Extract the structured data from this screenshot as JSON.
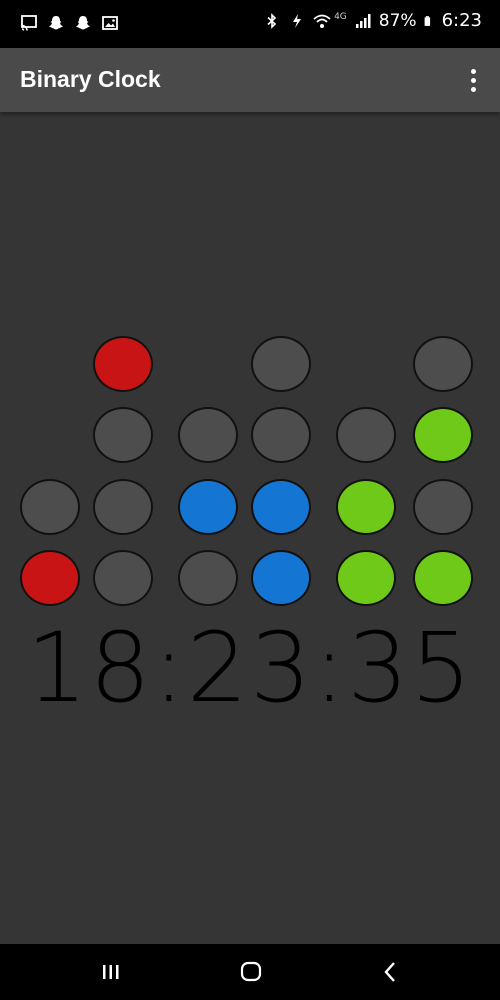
{
  "status_bar": {
    "battery": "87%",
    "time": "6:23",
    "left_icons": [
      "cast-icon",
      "snapchat-icon",
      "snapchat-icon",
      "image-icon"
    ],
    "right_icons": [
      "bluetooth-icon",
      "data-saver-icon",
      "wifi-icon",
      "signal-icon",
      "battery-icon"
    ],
    "network_label": "4G"
  },
  "app_bar": {
    "title": "Binary Clock",
    "menu_icon": "more-vert-icon"
  },
  "colors": {
    "background": "#353535",
    "off": "#4d4d4d",
    "hours_on": "#c81414",
    "minutes_on": "#1476d2",
    "seconds_on": "#6fc918",
    "border": "#111111"
  },
  "clock": {
    "time_text": "18:23:35",
    "hours": 18,
    "minutes": 23,
    "seconds": 35,
    "columns": [
      {
        "unit": "hours",
        "digit": 1,
        "bits": [
          null,
          null,
          0,
          1
        ]
      },
      {
        "unit": "hours",
        "digit": 8,
        "bits": [
          1,
          0,
          0,
          0
        ]
      },
      {
        "unit": "minutes",
        "digit": 2,
        "bits": [
          null,
          0,
          1,
          0
        ]
      },
      {
        "unit": "minutes",
        "digit": 3,
        "bits": [
          0,
          0,
          1,
          1
        ]
      },
      {
        "unit": "seconds",
        "digit": 3,
        "bits": [
          null,
          0,
          1,
          1
        ]
      },
      {
        "unit": "seconds",
        "digit": 5,
        "bits": [
          0,
          1,
          0,
          1
        ]
      }
    ]
  },
  "nav_bar": {
    "recent_icon": "recent-apps-icon",
    "home_icon": "home-icon",
    "back_icon": "back-icon"
  }
}
